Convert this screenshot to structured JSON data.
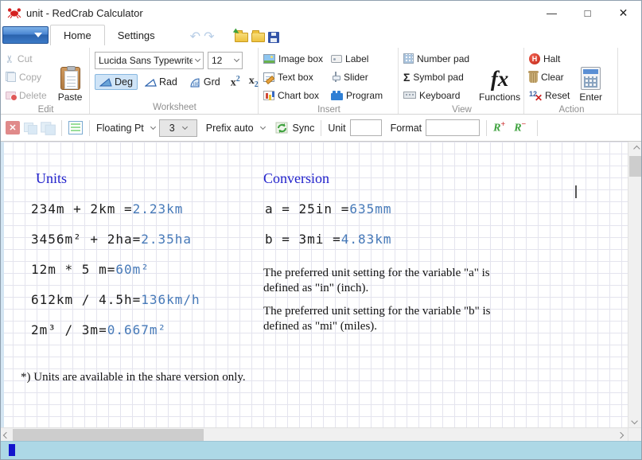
{
  "window": {
    "title": "unit - RedCrab Calculator",
    "minimize": "—",
    "maximize": "□",
    "close": "✕"
  },
  "tabs": {
    "home": "Home",
    "settings": "Settings"
  },
  "quickbar": {
    "undo": "↶",
    "redo": "↷"
  },
  "ribbon": {
    "edit": {
      "label": "Edit",
      "cut": "Cut",
      "copy": "Copy",
      "delete": "Delete",
      "paste": "Paste",
      "scissors_glyph": "✂"
    },
    "worksheet": {
      "label": "Worksheet",
      "font_name": "Lucida Sans Typewrite",
      "font_size": "12",
      "deg": "Deg",
      "rad": "Rad",
      "grd": "Grd",
      "sup_base": "x",
      "sup_exp": "2",
      "sub_base": "x",
      "sub_idx": "2"
    },
    "insert": {
      "label": "Insert",
      "image_box": "Image box",
      "text_box": "Text box",
      "chart_box": "Chart box",
      "label_item": "Label",
      "slider": "Slider",
      "program": "Program"
    },
    "view": {
      "label": "View",
      "number_pad": "Number pad",
      "symbol_pad": "Symbol pad",
      "keyboard": "Keyboard",
      "functions": "Functions",
      "fx_glyph": "fx",
      "sigma_glyph": "Σ"
    },
    "action": {
      "label": "Action",
      "halt": "Halt",
      "halt_letter": "H",
      "clear": "Clear",
      "reset": "Reset",
      "reset_num": "12",
      "reset_x_glyph": "✕",
      "enter": "Enter"
    }
  },
  "formatbar": {
    "delete_x_glyph": "✕",
    "floating_pt": "Floating Pt",
    "precision": "3",
    "prefix": "Prefix auto",
    "sync": "Sync",
    "unit_label": "Unit",
    "unit_value": "",
    "format_label": "Format",
    "format_value": "",
    "r_letter": "R",
    "plus_glyph": "+",
    "minus_glyph": "−"
  },
  "sheet": {
    "left_heading": "Units",
    "right_heading": "Conversion",
    "left_equations": [
      {
        "expr": "234m + 2km =",
        "result": "2.23km"
      },
      {
        "expr": "3456m² + 2ha=",
        "result": "2.35ha"
      },
      {
        "expr": "12m * 5 m=",
        "result": "60m²"
      },
      {
        "expr": "612km / 4.5h=",
        "result": "136km/h"
      },
      {
        "expr": "2m³ / 3m=",
        "result": "0.667m²"
      }
    ],
    "right_equations": [
      {
        "expr": "a = 25in =",
        "result": "635mm"
      },
      {
        "expr": "b = 3mi =",
        "result": "4.83km"
      }
    ],
    "notes": [
      "The preferred unit setting for the variable \"a\" is defined as \"in\" (inch).",
      "The preferred unit setting for the variable \"b\" is defined as \"mi\" (miles)."
    ],
    "footnote": "*) Units are available in the share version only."
  },
  "colors": {
    "result_blue": "#4679b8",
    "heading_blue": "#2222cc",
    "status_bg": "#add8e6",
    "accent": "#2a62ad"
  }
}
